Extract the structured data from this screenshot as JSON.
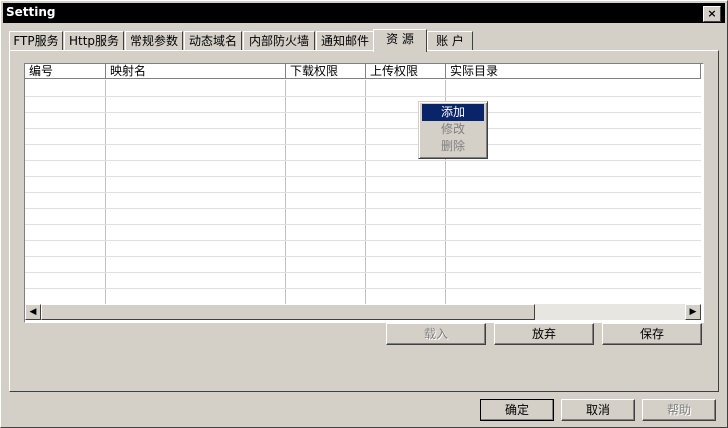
{
  "window": {
    "title": "Setting",
    "close_glyph": "×"
  },
  "tabs": [
    {
      "label": "FTP服务"
    },
    {
      "label": "Http服务"
    },
    {
      "label": "常规参数"
    },
    {
      "label": "动态域名"
    },
    {
      "label": "内部防火墙"
    },
    {
      "label": "通知邮件"
    },
    {
      "label": "资 源",
      "active": true
    },
    {
      "label": "账 户"
    }
  ],
  "table": {
    "columns": [
      "编号",
      "映射名",
      "下载权限",
      "上传权限",
      "实际目录"
    ],
    "rows": []
  },
  "context_menu": {
    "items": [
      {
        "label": "添加",
        "state": "highlighted"
      },
      {
        "label": "修改",
        "state": "disabled"
      },
      {
        "label": "删除",
        "state": "disabled"
      }
    ]
  },
  "panel_buttons": {
    "load": "载入",
    "discard": "放弃",
    "save": "保存"
  },
  "dialog_buttons": {
    "ok": "确定",
    "cancel": "取消",
    "help": "帮助"
  },
  "scroll": {
    "left_glyph": "◀",
    "right_glyph": "▶"
  },
  "colors": {
    "menu_highlight": "#0a246a",
    "face": "#d4d0c8"
  }
}
